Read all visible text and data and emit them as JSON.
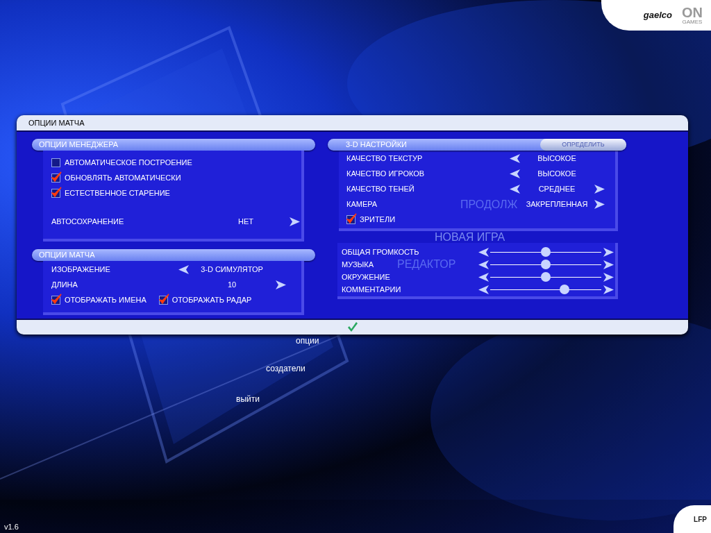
{
  "logos": {
    "gaelco": "gaelco",
    "on": "ON",
    "games": "GAMES",
    "lfp": "LFP"
  },
  "background_menu": [
    {
      "label": "ПРОДОЛЖ"
    },
    {
      "label": "НОВАЯ ИГРА"
    },
    {
      "label": "РЕДАКТОР"
    },
    {
      "label": "опции"
    },
    {
      "label": "создатели"
    },
    {
      "label": "выйти"
    }
  ],
  "panel": {
    "title": "ОПЦИИ МАТЧА"
  },
  "manager_options": {
    "title": "ОПЦИИ МЕНЕДЖЕРА",
    "checkboxes": [
      {
        "label": "АВТОМАТИЧЕСКОЕ ПОСТРОЕНИЕ",
        "checked": false
      },
      {
        "label": "ОБНОВЛЯТЬ АВТОМАТИЧЕСКИ",
        "checked": true
      },
      {
        "label": "ЕСТЕСТВЕННОЕ СТАРЕНИЕ",
        "checked": true
      }
    ],
    "rows": [
      {
        "label": "АВТОСОХРАНЕНИЕ",
        "value": "НЕТ",
        "left_arrow": false,
        "right_arrow": true
      }
    ]
  },
  "match_options": {
    "title": "ОПЦИИ МАТЧА",
    "rows": [
      {
        "label": "ИЗОБРАЖЕНИЕ",
        "value": "3-D СИМУЛЯТОР",
        "left_arrow": true,
        "right_arrow": false
      },
      {
        "label": "ДЛИНА",
        "value": "10",
        "left_arrow": false,
        "right_arrow": true
      }
    ],
    "checkboxes": [
      {
        "label": "ОТОБРАЖАТЬ ИМЕНА",
        "checked": true
      },
      {
        "label": "ОТОБРАЖАТЬ РАДАР",
        "checked": true
      }
    ]
  },
  "graphics": {
    "title": "3-D НАСТРОЙКИ",
    "detect_button": "ОПРЕДЕЛИТЬ",
    "rows": [
      {
        "label": "КАЧЕСТВО ТЕКСТУР",
        "value": "ВЫСОКОЕ",
        "left_arrow": true,
        "right_arrow": false
      },
      {
        "label": "КАЧЕСТВО ИГРОКОВ",
        "value": "ВЫСОКОЕ",
        "left_arrow": true,
        "right_arrow": false
      },
      {
        "label": "КАЧЕСТВО ТЕНЕЙ",
        "value": "СРЕДНЕЕ",
        "left_arrow": true,
        "right_arrow": true
      },
      {
        "label": "КАМЕРА",
        "value": "ЗАКРЕПЛЕННАЯ",
        "left_arrow": false,
        "right_arrow": true
      }
    ],
    "checkboxes": [
      {
        "label": "ЗРИТЕЛИ",
        "checked": true
      }
    ]
  },
  "volume": [
    {
      "label": "ОБЩАЯ ГРОМКОСТЬ",
      "level": 0.5
    },
    {
      "label": "МУЗЫКА",
      "level": 0.5
    },
    {
      "label": "ОКРУЖЕНИЕ",
      "level": 0.5
    },
    {
      "label": "КОММЕНТАРИИ",
      "level": 0.67
    }
  ],
  "version": "v1.6"
}
